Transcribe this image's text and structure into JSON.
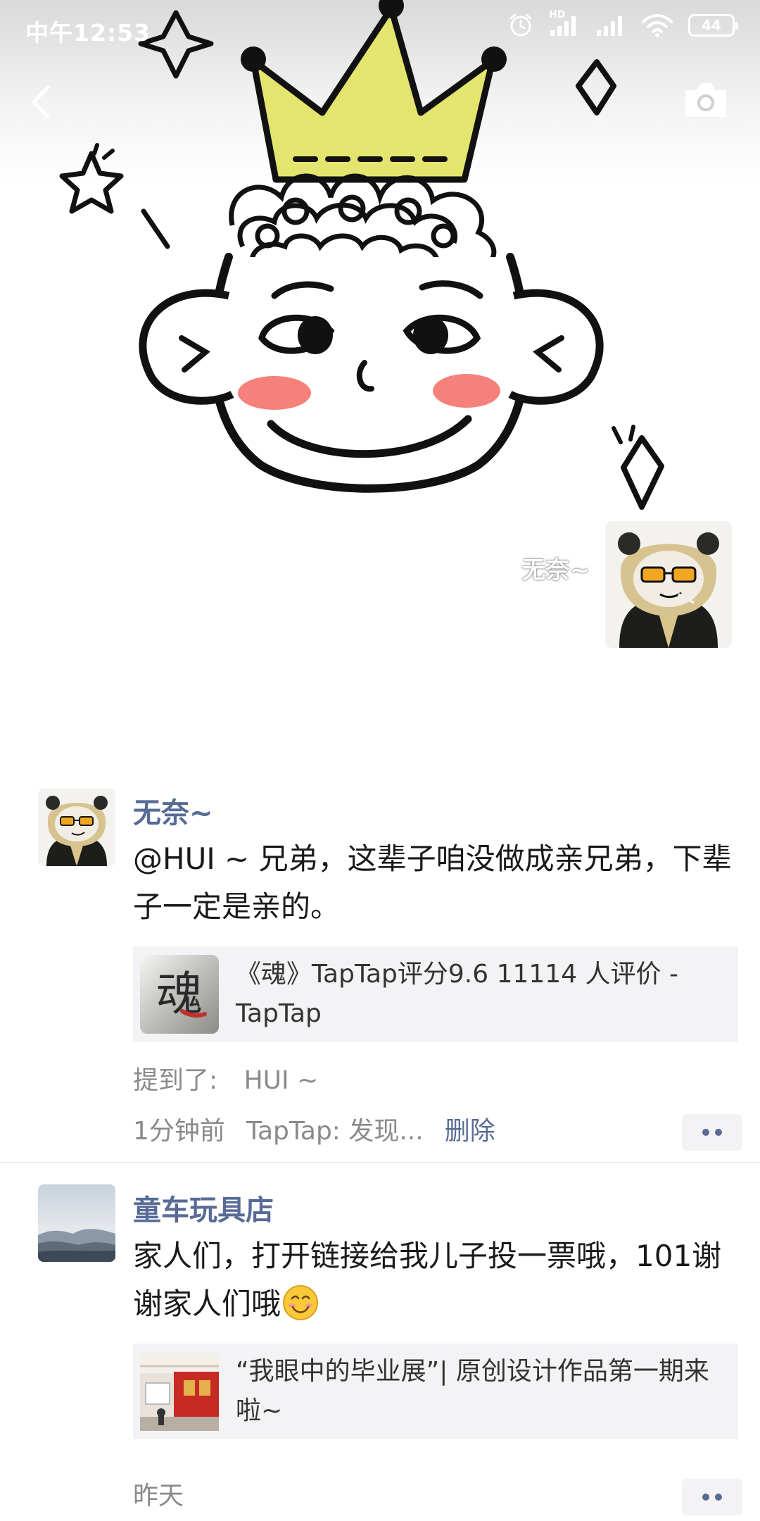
{
  "status_bar": {
    "time": "中午12:53",
    "network_label": "HD",
    "battery": "44"
  },
  "cover": {
    "owner_name": "无奈~"
  },
  "posts": [
    {
      "author": "无奈~",
      "text": "@HUI ~ 兄弟，这辈子咱没做成亲兄弟，下辈子一定是亲的。",
      "link": {
        "title": "《魂》TapTap评分9.6 11114 人评价 - TapTap",
        "thumb_glyph": "魂"
      },
      "mention_label": "提到了:",
      "mention_name": "HUI ~",
      "time": "1分钟前",
      "source": "TapTap: 发现...",
      "delete_label": "删除"
    },
    {
      "author": "童车玩具店",
      "text": "家人们，打开链接给我儿子投一票哦，101谢谢家人们哦",
      "emoji": "smile-emoji",
      "link": {
        "title": "“我眼中的毕业展”| 原创设计作品第一期来啦~"
      },
      "time": "昨天"
    }
  ],
  "colors": {
    "link_blue": "#576b95",
    "crown_yellow": "#e4e56f",
    "blush": "#f5726c",
    "card_bg": "#f3f3f5"
  }
}
